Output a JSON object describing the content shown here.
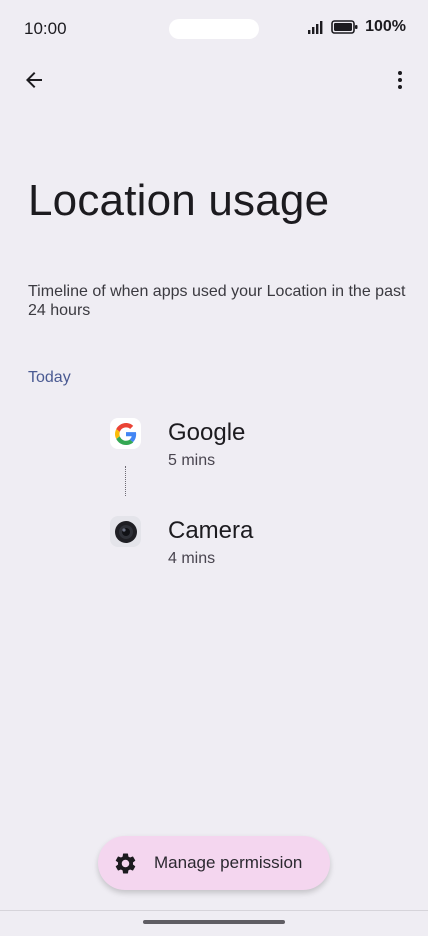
{
  "status_bar": {
    "time": "10:00",
    "battery": "100%"
  },
  "header": {
    "title": "Location usage"
  },
  "description": "Timeline of when apps used your Location in the past 24 hours",
  "section": {
    "label": "Today"
  },
  "timeline": [
    {
      "app": "Google",
      "duration": "5 mins",
      "icon": "google-g-icon"
    },
    {
      "app": "Camera",
      "duration": "4 mins",
      "icon": "camera-lens-icon"
    }
  ],
  "action": {
    "label": "Manage permission",
    "icon": "gear-icon"
  },
  "colors": {
    "background": "#efedf3",
    "accent_text": "#4a5a92",
    "fab_background": "#f4d6ef"
  }
}
